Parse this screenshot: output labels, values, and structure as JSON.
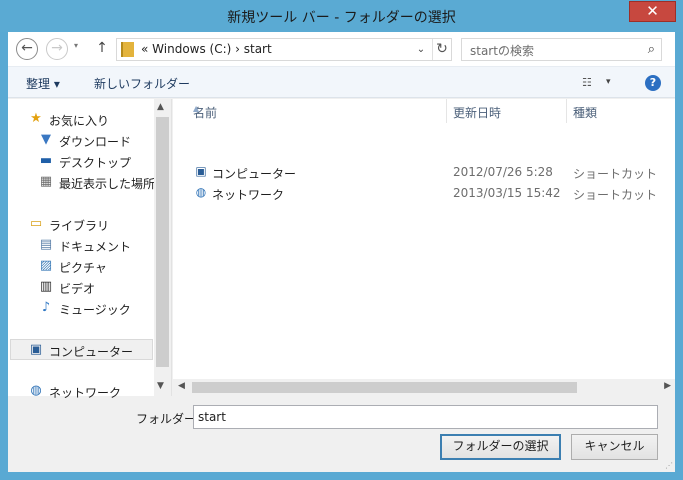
{
  "window": {
    "title": "新規ツール バー - フォルダーの選択",
    "close_icon": "close-icon",
    "close_glyph": "✕"
  },
  "nav": {
    "back_glyph": "←",
    "forward_glyph": "→",
    "recent_glyph": "▾",
    "up_glyph": "↑"
  },
  "address": {
    "path": "«  Windows (C:)  ›  start",
    "dropdown_glyph": "⌄",
    "refresh_glyph": "↻"
  },
  "search": {
    "placeholder": "startの検索",
    "icon_glyph": "⌕"
  },
  "toolbar": {
    "organize_label": "整理 ▾",
    "new_folder_label": "新しいフォルダー",
    "view_glyph": "☷",
    "view_dd_glyph": "▾",
    "help_glyph": "?"
  },
  "sidebar": {
    "items": [
      {
        "label": "お気に入り",
        "icon": "★"
      },
      {
        "label": "ダウンロード",
        "icon": "▼"
      },
      {
        "label": "デスクトップ",
        "icon": "▬"
      },
      {
        "label": "最近表示した場所",
        "icon": "▦"
      },
      {
        "label": "ライブラリ",
        "icon": "▭"
      },
      {
        "label": "ドキュメント",
        "icon": "▤"
      },
      {
        "label": "ピクチャ",
        "icon": "▨"
      },
      {
        "label": "ビデオ",
        "icon": "▥"
      },
      {
        "label": "ミュージック",
        "icon": "♪"
      },
      {
        "label": "コンピューター",
        "icon": "▣"
      },
      {
        "label": "ネットワーク",
        "icon": "◍"
      }
    ]
  },
  "columns": {
    "name": "名前",
    "modified": "更新日時",
    "type": "種類",
    "sort_glyph": "▲"
  },
  "files": [
    {
      "name": "コンピューター",
      "modified": "2012/07/26 5:28",
      "type": "ショートカット",
      "icon": "▣"
    },
    {
      "name": "ネットワーク",
      "modified": "2013/03/15 15:42",
      "type": "ショートカット",
      "icon": "◍"
    }
  ],
  "scroll": {
    "up_glyph": "▲",
    "down_glyph": "▼",
    "left_glyph": "◀",
    "right_glyph": "▶"
  },
  "footer": {
    "folder_label": "フォルダー:",
    "folder_value": "start",
    "select_button": "フォルダーの選択",
    "cancel_button": "キャンセル",
    "grip_glyph": "⋰"
  },
  "colors": {
    "titlebar": "#5aaad3",
    "close": "#c7483f",
    "primary_border": "#3c7fb1"
  }
}
